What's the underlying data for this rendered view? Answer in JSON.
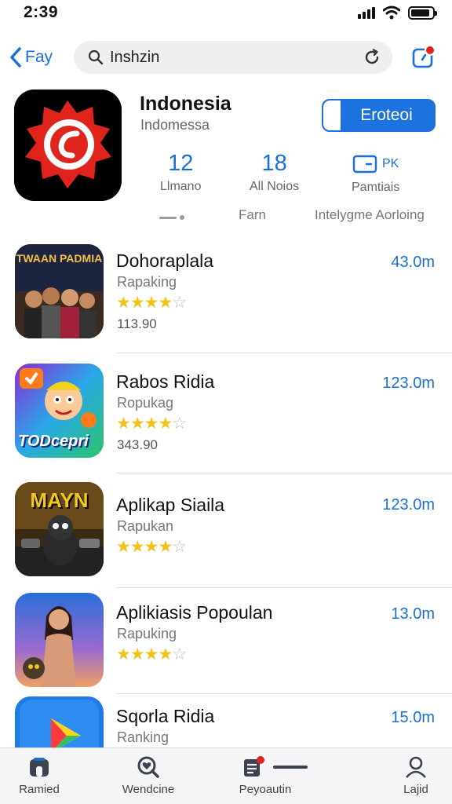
{
  "status": {
    "time": "2:39"
  },
  "nav": {
    "back_label": "Fay",
    "search_value": "Inshzin"
  },
  "app": {
    "title": "Indonesia",
    "subtitle": "Indomessa",
    "primary_button": "Eroteoi",
    "stats": [
      {
        "value": "12",
        "label": "Llmano"
      },
      {
        "value": "18",
        "label": "All Noios"
      },
      {
        "value": "PK",
        "label": "Pamtiais"
      }
    ],
    "tabs": [
      "Farn",
      "Intelygme Aorloing"
    ]
  },
  "list": [
    {
      "title": "Dohoraplala",
      "subtitle": "Rapaking",
      "rating": 4,
      "count": "113.90",
      "size": "43.0m",
      "icon_text": "TWAAN PADMIA"
    },
    {
      "title": "Rabos Ridia",
      "subtitle": "Ropukag",
      "rating": 4,
      "count": "343.90",
      "size": "123.0m",
      "icon_text": "TODcepri"
    },
    {
      "title": "Aplikap Siaila",
      "subtitle": "Rapukan",
      "rating": 4,
      "count": "",
      "size": "123.0m",
      "icon_text": "MAYN"
    },
    {
      "title": "Aplikiasis Popoulan",
      "subtitle": "Rapuking",
      "rating": 4,
      "count": "",
      "size": "13.0m",
      "icon_text": ""
    },
    {
      "title": "Sqorla Ridia",
      "subtitle": "Ranking",
      "rating": 0,
      "count": "",
      "size": "15.0m",
      "icon_text": ""
    }
  ],
  "tab_bar": [
    {
      "label": "Ramied",
      "icon": "home-icon"
    },
    {
      "label": "Wendcine",
      "icon": "search-heart-icon"
    },
    {
      "label": "Peyoautin",
      "icon": "updates-icon"
    },
    {
      "label": "Lajid",
      "icon": "person-icon"
    }
  ],
  "colors": {
    "accent": "#1c73e0",
    "star": "#f3c218",
    "brand_red": "#e0241b"
  }
}
